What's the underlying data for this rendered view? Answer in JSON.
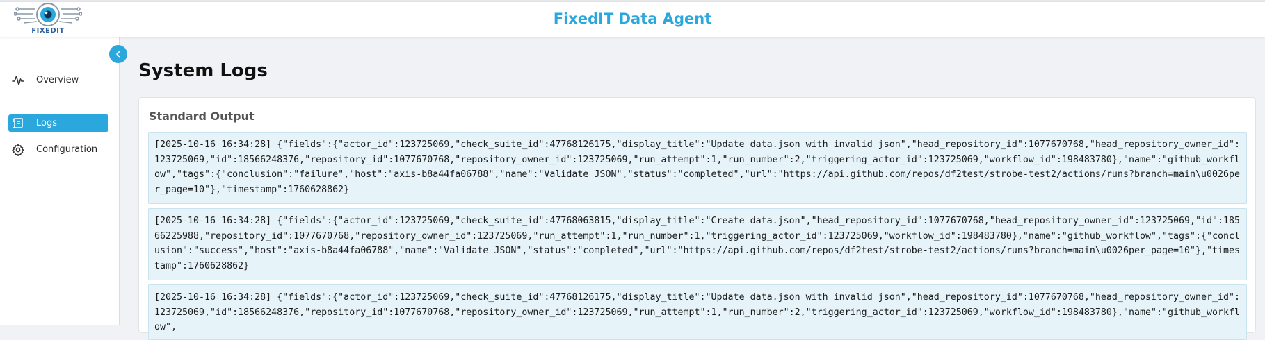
{
  "header": {
    "logo_text": "FIXEDIT",
    "app_title": "FixedIT Data Agent"
  },
  "sidebar": {
    "collapse_icon": "chevron-left-icon",
    "items": [
      {
        "label": "Overview",
        "icon": "activity-icon",
        "active": false
      },
      {
        "label": "Logs",
        "icon": "scroll-icon",
        "active": true
      },
      {
        "label": "Configuration",
        "icon": "gear-icon",
        "active": false
      }
    ]
  },
  "main": {
    "page_title": "System Logs",
    "card_title": "Standard Output",
    "logs": [
      "[2025-10-16 16:34:28] {\"fields\":{\"actor_id\":123725069,\"check_suite_id\":47768126175,\"display_title\":\"Update data.json with invalid json\",\"head_repository_id\":1077670768,\"head_repository_owner_id\":123725069,\"id\":18566248376,\"repository_id\":1077670768,\"repository_owner_id\":123725069,\"run_attempt\":1,\"run_number\":2,\"triggering_actor_id\":123725069,\"workflow_id\":198483780},\"name\":\"github_workflow\",\"tags\":{\"conclusion\":\"failure\",\"host\":\"axis-b8a44fa06788\",\"name\":\"Validate JSON\",\"status\":\"completed\",\"url\":\"https://api.github.com/repos/df2test/strobe-test2/actions/runs?branch=main\\u0026per_page=10\"},\"timestamp\":1760628862}",
      "[2025-10-16 16:34:28] {\"fields\":{\"actor_id\":123725069,\"check_suite_id\":47768063815,\"display_title\":\"Create data.json\",\"head_repository_id\":1077670768,\"head_repository_owner_id\":123725069,\"id\":18566225988,\"repository_id\":1077670768,\"repository_owner_id\":123725069,\"run_attempt\":1,\"run_number\":1,\"triggering_actor_id\":123725069,\"workflow_id\":198483780},\"name\":\"github_workflow\",\"tags\":{\"conclusion\":\"success\",\"host\":\"axis-b8a44fa06788\",\"name\":\"Validate JSON\",\"status\":\"completed\",\"url\":\"https://api.github.com/repos/df2test/strobe-test2/actions/runs?branch=main\\u0026per_page=10\"},\"timestamp\":1760628862}",
      "[2025-10-16 16:34:28] {\"fields\":{\"actor_id\":123725069,\"check_suite_id\":47768126175,\"display_title\":\"Update data.json with invalid json\",\"head_repository_id\":1077670768,\"head_repository_owner_id\":123725069,\"id\":18566248376,\"repository_id\":1077670768,\"repository_owner_id\":123725069,\"run_attempt\":1,\"run_number\":2,\"triggering_actor_id\":123725069,\"workflow_id\":198483780},\"name\":\"github_workflow\","
    ]
  },
  "colors": {
    "accent": "#2aa7dd",
    "log_background": "#e6f4fa",
    "page_background": "#f1f2f5"
  }
}
